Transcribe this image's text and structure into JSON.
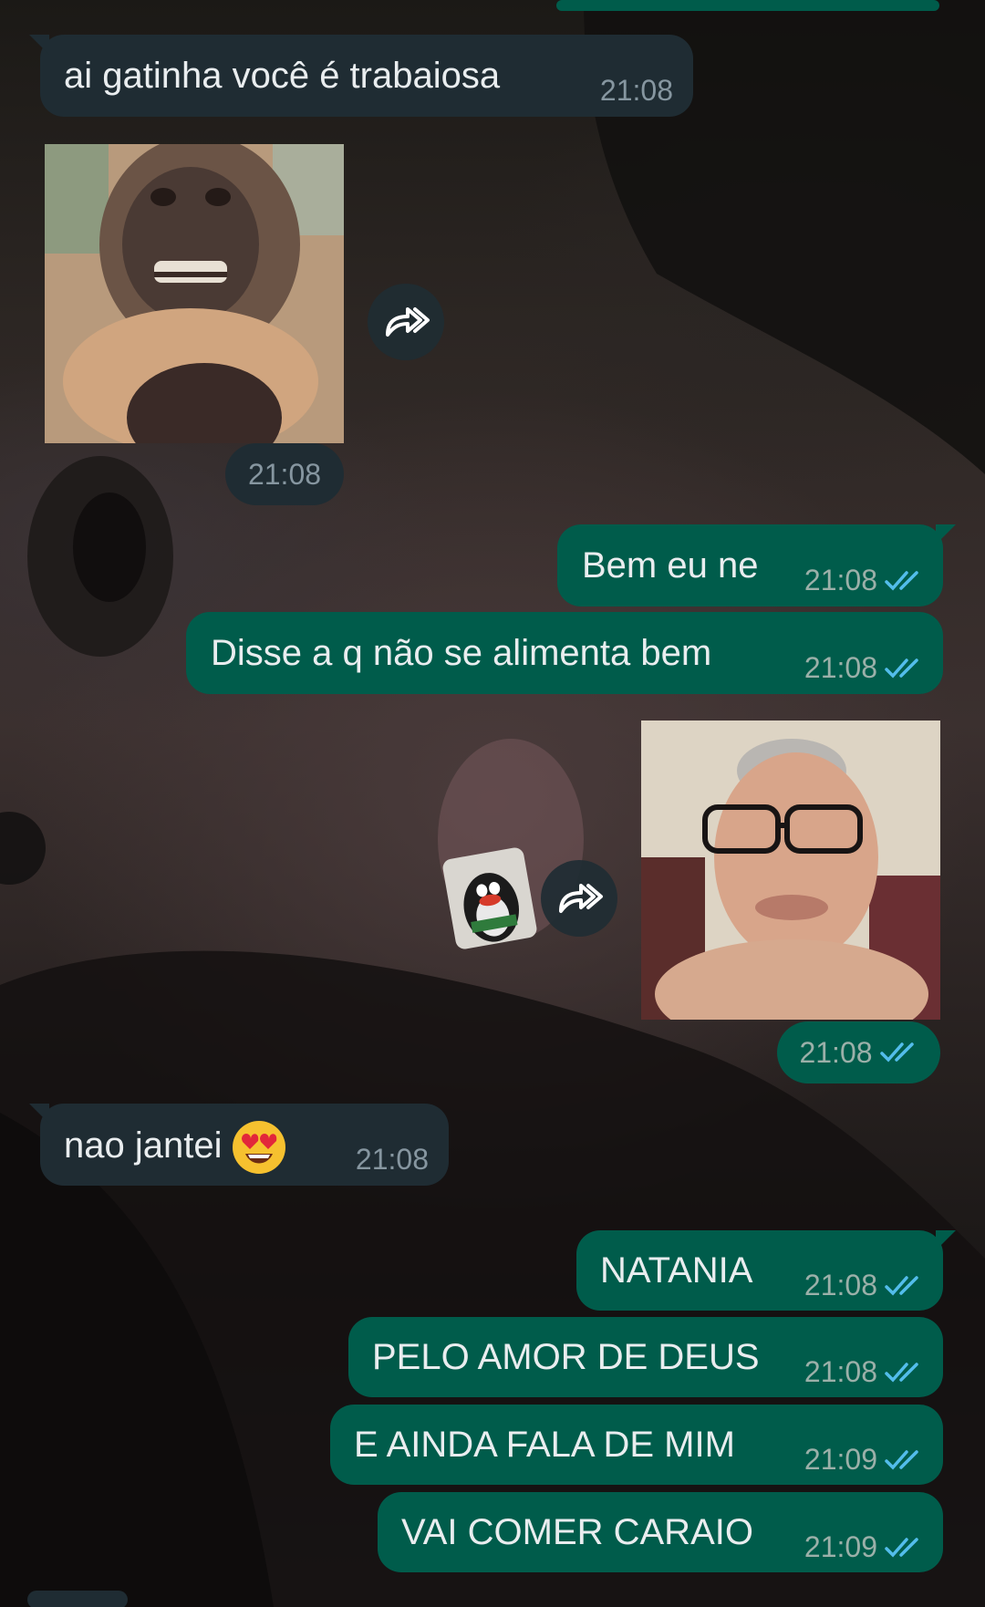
{
  "chat": {
    "messages": [
      {
        "id": "m1",
        "direction": "in",
        "text": "ai gatinha você é trabaiosa",
        "time": "21:08"
      },
      {
        "id": "m2",
        "direction": "in",
        "type": "image",
        "image_desc": "monkey",
        "time": "21:08"
      },
      {
        "id": "m3",
        "direction": "out",
        "text": "Bem eu ne",
        "time": "21:08",
        "status": "read"
      },
      {
        "id": "m4",
        "direction": "out",
        "text": "Disse a q não se alimenta bem",
        "time": "21:08",
        "status": "read"
      },
      {
        "id": "m5",
        "direction": "out",
        "type": "image",
        "image_desc": "man-with-glasses",
        "time": "21:08",
        "status": "read"
      },
      {
        "id": "m6",
        "direction": "in",
        "text": "nao jantei",
        "emoji": "heart-eyes",
        "time": "21:08"
      },
      {
        "id": "m7",
        "direction": "out",
        "text": "NATANIA",
        "time": "21:08",
        "status": "read"
      },
      {
        "id": "m8",
        "direction": "out",
        "text": "PELO AMOR DE DEUS",
        "time": "21:08",
        "status": "read"
      },
      {
        "id": "m9",
        "direction": "out",
        "text": "E AINDA FALA DE MIM",
        "time": "21:09",
        "status": "read"
      },
      {
        "id": "m10",
        "direction": "out",
        "text": "VAI COMER CARAIO",
        "time": "21:09",
        "status": "read"
      }
    ]
  },
  "icons": {
    "forward": "forward-icon",
    "read_receipt": "double-check-icon"
  },
  "colors": {
    "incoming_bubble": "#1f2c33",
    "outgoing_bubble": "#005c4b",
    "text": "#e9edef",
    "read_tick": "#53bdeb",
    "time_out": "#9bb0a9",
    "time_in": "#8696a0"
  }
}
